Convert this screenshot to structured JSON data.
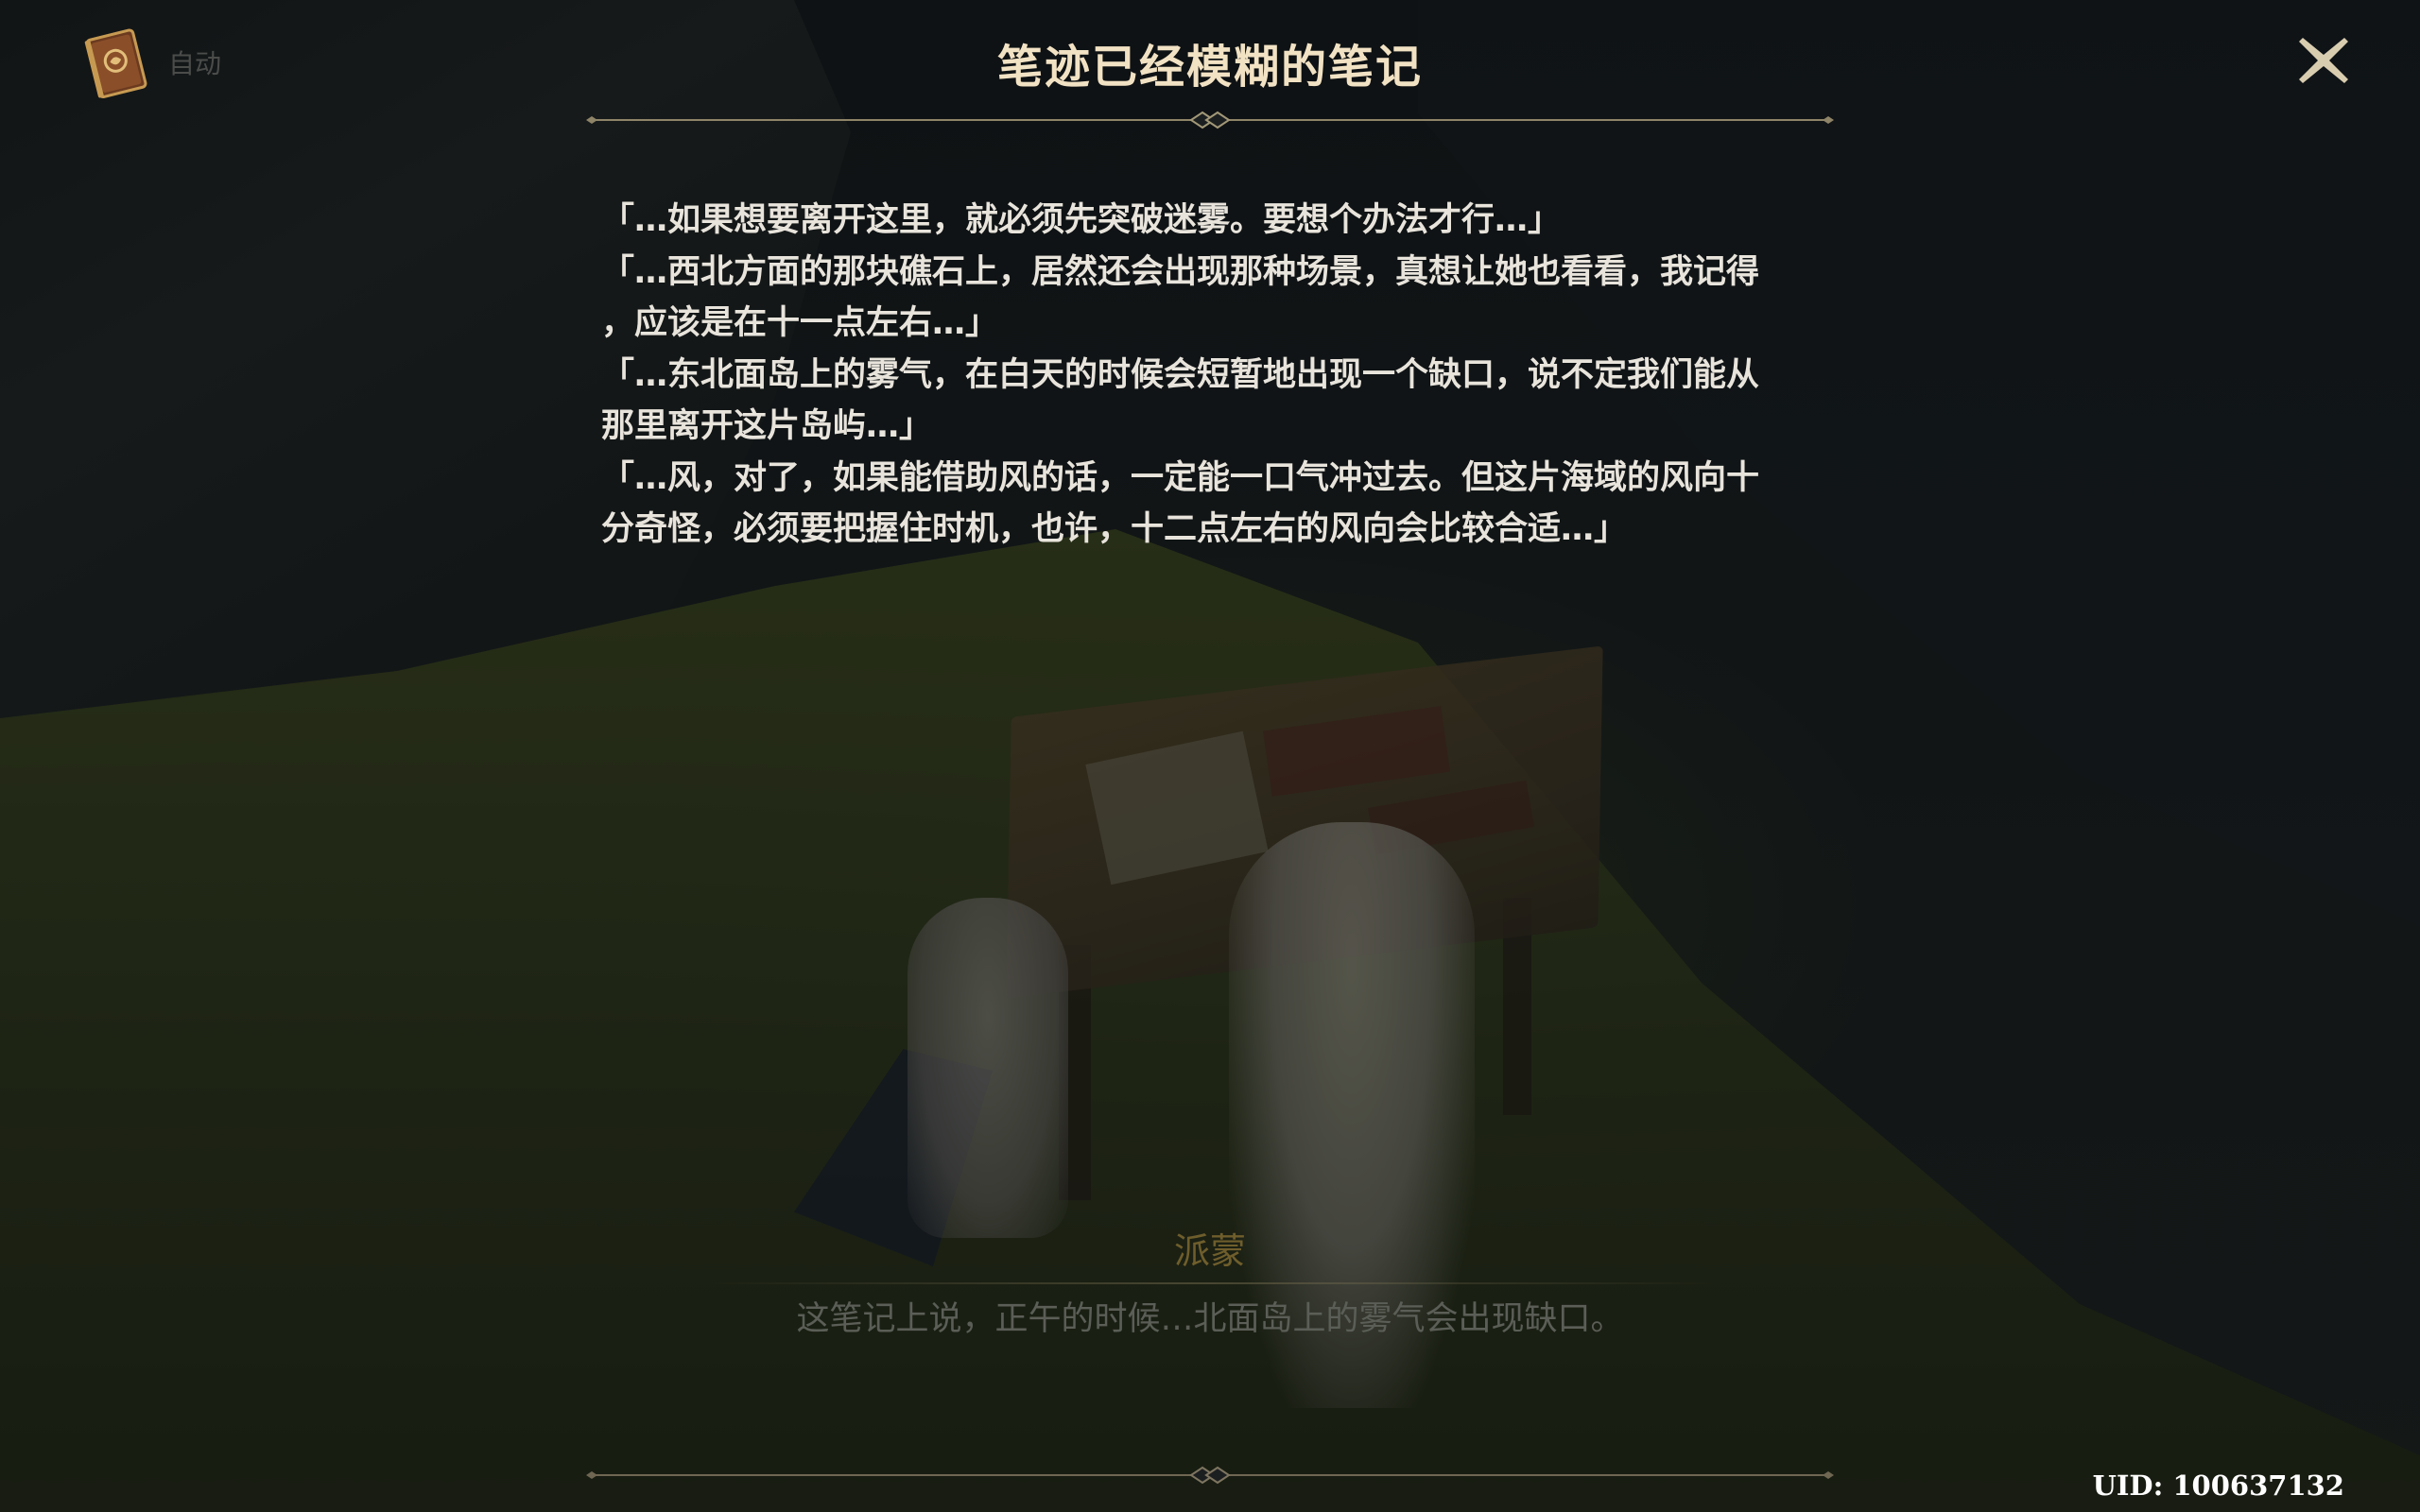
{
  "header": {
    "auto_label": "自动",
    "title": "笔迹已经模糊的笔记",
    "book_icon": "book-icon",
    "close_icon": "close-icon"
  },
  "note": {
    "lines": [
      "「…如果想要离开这里，就必须先突破迷雾。要想个办法才行…」",
      "「…西北方面的那块礁石上，居然还会出现那种场景，真想让她也看看，我记得",
      "，应该是在十一点左右…」",
      "「…东北面岛上的雾气，在白天的时候会短暂地出现一个缺口，说不定我们能从",
      "那里离开这片岛屿…」",
      "「…风，对了，如果能借助风的话，一定能一口气冲过去。但这片海域的风向十",
      "分奇怪，必须要把握住时机，也许，十二点左右的风向会比较合适…」"
    ]
  },
  "dialog": {
    "speaker": "派蒙",
    "text": "这笔记上说，正午的时候…北面岛上的雾气会出现缺口。"
  },
  "footer": {
    "uid": "UID: 100637132"
  },
  "colors": {
    "title": "#f2e2c4",
    "body_text": "#e8e4dc",
    "divider": "#8e8468",
    "speaker": "#6f5e2c",
    "close_icon": "#d9cdb0"
  }
}
